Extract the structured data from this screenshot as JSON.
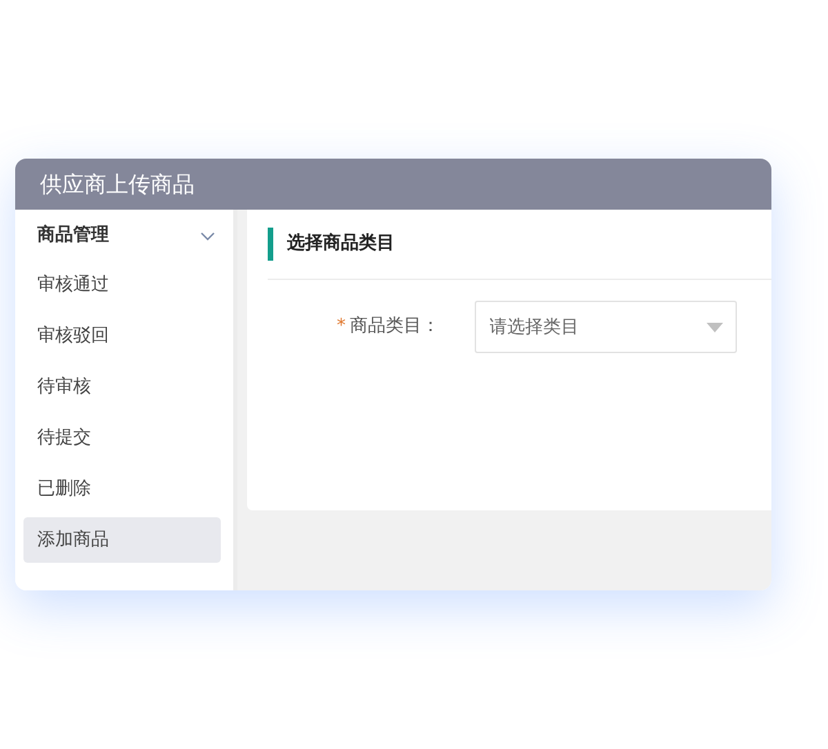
{
  "window": {
    "title": "供应商上传商品"
  },
  "sidebar": {
    "group": {
      "label": "商品管理",
      "expanded": true
    },
    "items": [
      {
        "label": "审核通过",
        "selected": false
      },
      {
        "label": "审核驳回",
        "selected": false
      },
      {
        "label": "待审核",
        "selected": false
      },
      {
        "label": "待提交",
        "selected": false
      },
      {
        "label": "已删除",
        "selected": false
      },
      {
        "label": "添加商品",
        "selected": true
      }
    ]
  },
  "section": {
    "title": "选择商品类目"
  },
  "form": {
    "field": {
      "required_mark": "*",
      "label": "商品类目：",
      "placeholder": "请选择类目"
    }
  }
}
